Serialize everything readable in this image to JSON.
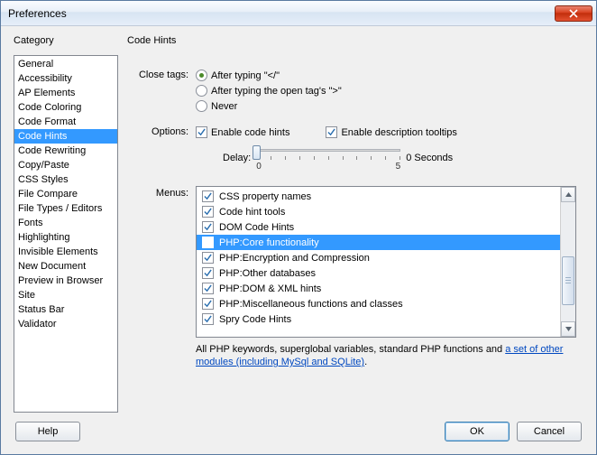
{
  "window": {
    "title": "Preferences"
  },
  "left": {
    "header": "Category",
    "items": [
      "General",
      "Accessibility",
      "AP Elements",
      "Code Coloring",
      "Code Format",
      "Code Hints",
      "Code Rewriting",
      "Copy/Paste",
      "CSS Styles",
      "File Compare",
      "File Types / Editors",
      "Fonts",
      "Highlighting",
      "Invisible Elements",
      "New Document",
      "Preview in Browser",
      "Site",
      "Status Bar",
      "Validator"
    ],
    "selected_index": 5
  },
  "right": {
    "header": "Code Hints",
    "close_tags": {
      "label": "Close tags:",
      "options": [
        "After typing \"</\"",
        "After typing the open tag's \">\"",
        "Never"
      ],
      "selected_index": 0
    },
    "options": {
      "label": "Options:",
      "enable_hints_label": "Enable code hints",
      "enable_hints_checked": true,
      "enable_tooltips_label": "Enable description tooltips",
      "enable_tooltips_checked": true,
      "delay_label": "Delay:",
      "delay_value": "0 Seconds",
      "delay_min": "0",
      "delay_max": "5"
    },
    "menus": {
      "label": "Menus:",
      "items": [
        {
          "label": "CSS property names",
          "checked": true
        },
        {
          "label": "Code hint tools",
          "checked": true
        },
        {
          "label": "DOM Code Hints",
          "checked": true
        },
        {
          "label": "PHP:Core functionality",
          "checked": true
        },
        {
          "label": "PHP:Encryption and Compression",
          "checked": true
        },
        {
          "label": "PHP:Other databases",
          "checked": true
        },
        {
          "label": "PHP:DOM & XML hints",
          "checked": true
        },
        {
          "label": "PHP:Miscellaneous functions and classes",
          "checked": true
        },
        {
          "label": "Spry Code Hints",
          "checked": true
        }
      ],
      "selected_index": 3
    },
    "description": {
      "prefix": "All PHP keywords, superglobal variables, standard PHP functions and ",
      "link": "a set of other modules (including MySql and SQLite)",
      "suffix": "."
    }
  },
  "buttons": {
    "help": "Help",
    "ok": "OK",
    "cancel": "Cancel"
  }
}
